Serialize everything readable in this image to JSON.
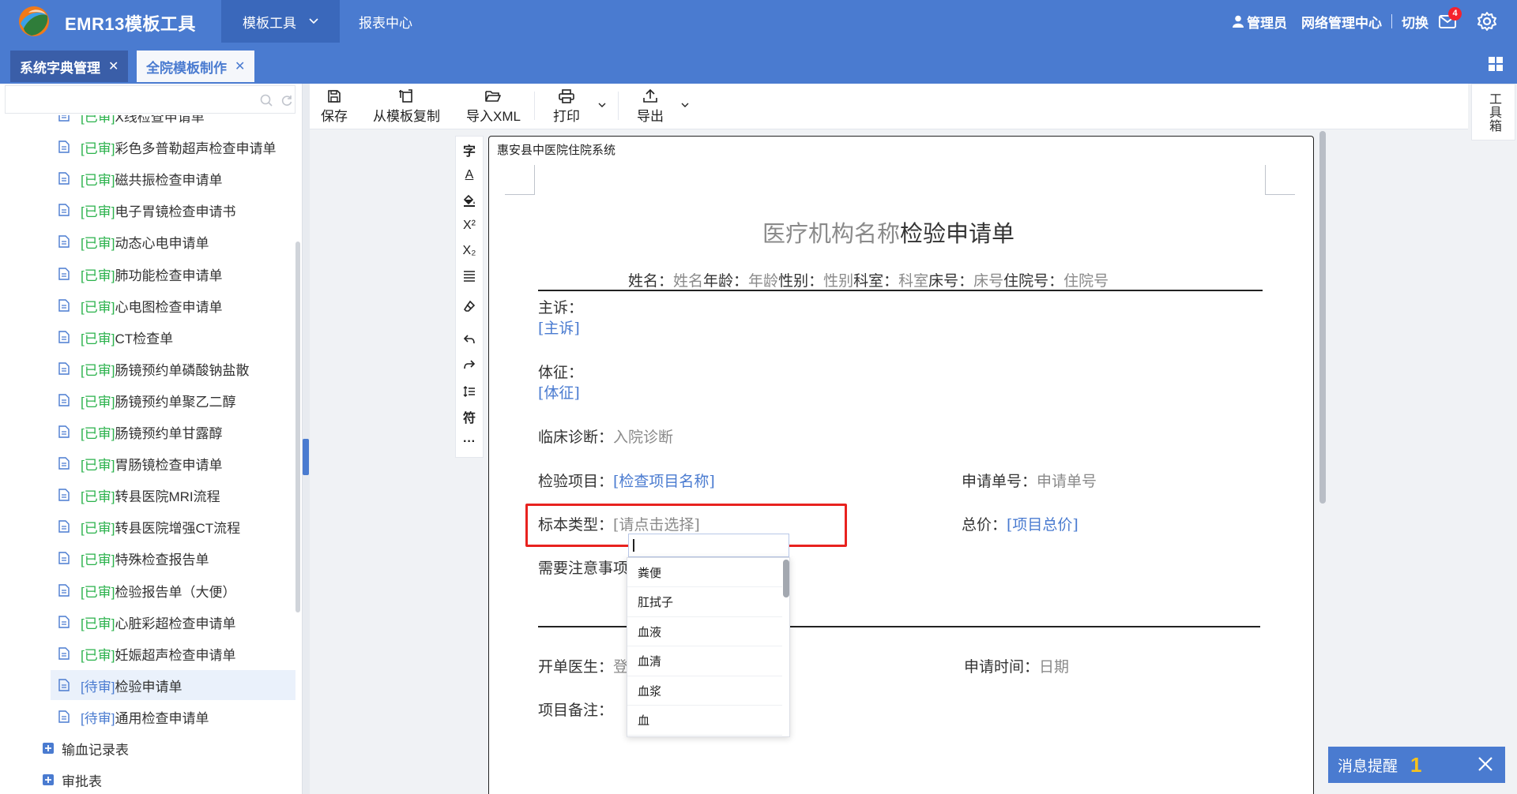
{
  "header": {
    "app_title": "EMR13模板工具",
    "nav": [
      {
        "label": "模板工具"
      },
      {
        "label": "报表中心"
      }
    ],
    "user": "管理员",
    "network": "网络管理中心",
    "switch": "切换",
    "mail_badge": "4",
    "accent": "#4a7bd0"
  },
  "tabs": [
    {
      "label": "系统字典管理",
      "close": "✕"
    },
    {
      "label": "全院模板制作",
      "close": "✕"
    }
  ],
  "tree": {
    "items": [
      {
        "status": "[已审]",
        "name": "X线检查申请单"
      },
      {
        "status": "[已审]",
        "name": "彩色多普勒超声检查申请单"
      },
      {
        "status": "[已审]",
        "name": "磁共振检查申请单"
      },
      {
        "status": "[已审]",
        "name": "电子胃镜检查申请书"
      },
      {
        "status": "[已审]",
        "name": "动态心电申请单"
      },
      {
        "status": "[已审]",
        "name": "肺功能检查申请单"
      },
      {
        "status": "[已审]",
        "name": "心电图检查申请单"
      },
      {
        "status": "[已审]",
        "name": "CT检查单"
      },
      {
        "status": "[已审]",
        "name": "肠镜预约单磷酸钠盐散"
      },
      {
        "status": "[已审]",
        "name": "肠镜预约单聚乙二醇"
      },
      {
        "status": "[已审]",
        "name": "肠镜预约单甘露醇"
      },
      {
        "status": "[已审]",
        "name": "胃肠镜检查申请单"
      },
      {
        "status": "[已审]",
        "name": "转县医院MRI流程"
      },
      {
        "status": "[已审]",
        "name": "转县医院增强CT流程"
      },
      {
        "status": "[已审]",
        "name": "特殊检查报告单"
      },
      {
        "status": "[已审]",
        "name": "检验报告单（大便）"
      },
      {
        "status": "[已审]",
        "name": "心脏彩超检查申请单"
      },
      {
        "status": "[已审]",
        "name": "妊娠超声检查申请单"
      },
      {
        "status": "[待审]",
        "name": "检验申请单"
      },
      {
        "status": "[待审]",
        "name": "通用检查申请单"
      }
    ],
    "folders": [
      {
        "name": "输血记录表"
      },
      {
        "name": "审批表"
      }
    ]
  },
  "toolbar": {
    "save": "保存",
    "copy": "从模板复制",
    "import": "导入XML",
    "print": "打印",
    "export": "导出"
  },
  "vtools": [
    "字",
    "A",
    "fill",
    "X²",
    "X₂",
    "align",
    "eraser",
    "undo",
    "redo",
    "spacing",
    "符",
    "···"
  ],
  "toolbox": "工具箱",
  "document": {
    "header": "惠安县中医院住院系统",
    "title_ph": "医疗机构名称",
    "title": "检验申请单",
    "info": [
      {
        "label": "姓名：",
        "value": "姓名"
      },
      {
        "label": "年龄：",
        "value": "年龄"
      },
      {
        "label": "性别：",
        "value": "性别"
      },
      {
        "label": "科室：",
        "value": "科室"
      },
      {
        "label": "床号：",
        "value": "床号"
      },
      {
        "label": "住院号：",
        "value": "住院号"
      }
    ],
    "complaint_label": "主诉：",
    "complaint_value": "[主诉]",
    "sign_label": "体征：",
    "sign_value": "[体征]",
    "diag_label": "临床诊断：",
    "diag_value": "入院诊断",
    "item_label": "检验项目：",
    "item_value": "[检查项目名称]",
    "appno_label": "申请单号：",
    "appno_value": "申请单号",
    "specimen_label": "标本类型：",
    "specimen_value": "[请点击选择]",
    "price_label": "总价：",
    "price_value": "[项目总价]",
    "notice_label": "需要注意事项：",
    "doctor_label": "开单医生：",
    "doctor_value": "登",
    "time_label": "申请时间：",
    "time_value": "日期",
    "remark_label": "项目备注："
  },
  "dropdown": {
    "options": [
      "粪便",
      "肛拭子",
      "血液",
      "血清",
      "血浆",
      "血"
    ]
  },
  "message": {
    "label": "消息提醒",
    "count": "1"
  }
}
